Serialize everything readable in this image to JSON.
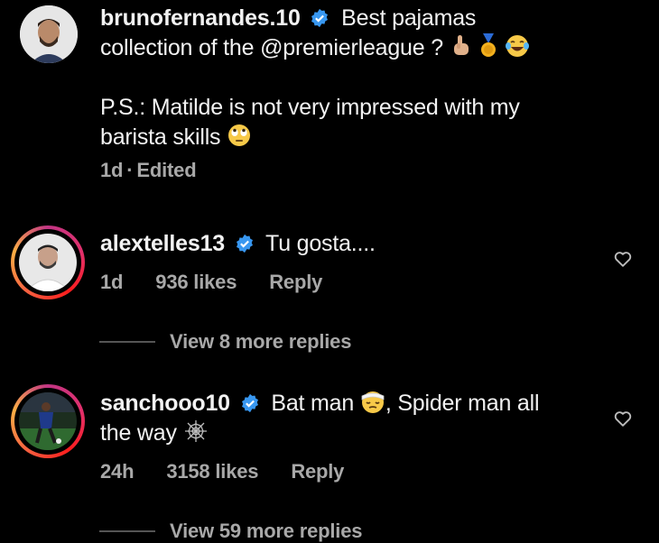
{
  "post": {
    "username": "brunofernandes.10",
    "caption_line1": "Best pajamas",
    "caption_line2": "collection of the @premierleague ?",
    "caption_ps_line1": "P.S.: Matilde is not very impressed with my",
    "caption_ps_line2": "barista skills",
    "time": "1d",
    "edited": "Edited",
    "separator": "·"
  },
  "comments": [
    {
      "username": "alextelles13",
      "text": "Tu gosta....",
      "time": "1d",
      "likes": "936 likes",
      "reply": "Reply",
      "view_replies": "View 8 more replies"
    },
    {
      "username": "sanchooo10",
      "text_line1a": "Bat man",
      "text_line1b": ", Spider man all",
      "text_line2": "the way",
      "time": "24h",
      "likes": "3158 likes",
      "reply": "Reply",
      "view_replies": "View 59 more replies"
    }
  ],
  "colors": {
    "background": "#000000",
    "text": "#f2f2f2",
    "muted": "#a8a8a8",
    "verified": "#3897f0"
  },
  "icons": [
    "verified-badge-icon",
    "pointing-hand-icon",
    "medal-icon",
    "laughing-emoji-icon",
    "eye-roll-emoji-icon",
    "heart-icon",
    "bandage-emoji-icon",
    "spider-web-icon"
  ]
}
